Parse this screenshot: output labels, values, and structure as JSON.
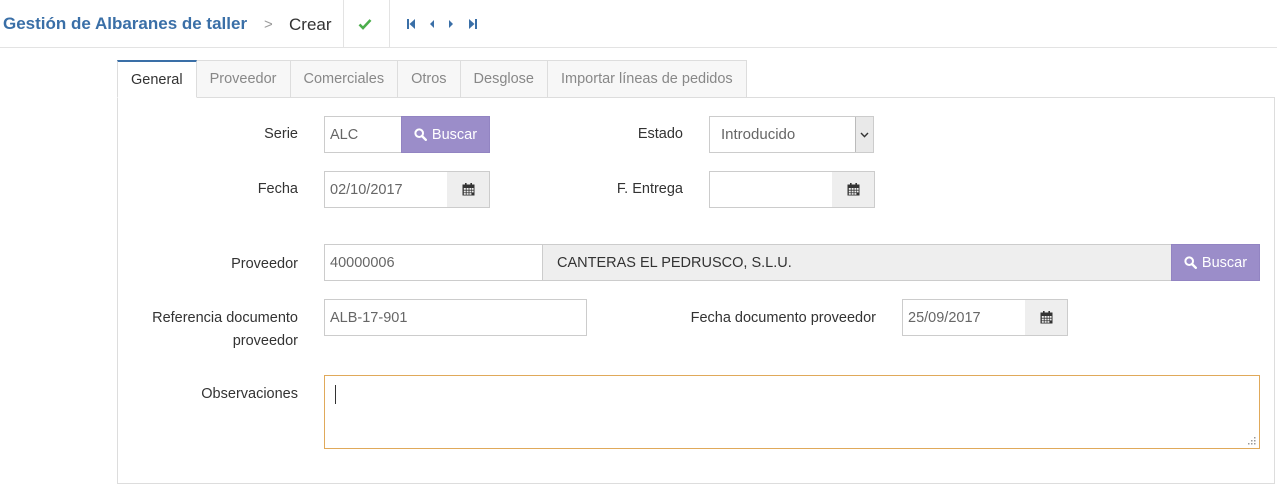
{
  "breadcrumb": {
    "app": "Gestión de Albaranes de taller",
    "separator": ">",
    "current": "Crear"
  },
  "toolbar": {
    "save_icon": "check-icon",
    "nav_icons": [
      "first-record-icon",
      "previous-record-icon",
      "next-record-icon",
      "last-record-icon"
    ],
    "colors": {
      "check": "#4cae4c",
      "nav": "#3a6fa7"
    }
  },
  "tabs": [
    {
      "label": "General",
      "active": true
    },
    {
      "label": "Proveedor",
      "active": false
    },
    {
      "label": "Comerciales",
      "active": false
    },
    {
      "label": "Otros",
      "active": false
    },
    {
      "label": "Desglose",
      "active": false
    },
    {
      "label": "Importar líneas de pedidos",
      "active": false
    }
  ],
  "form": {
    "serie": {
      "label": "Serie",
      "value": "ALC",
      "button": "Buscar"
    },
    "estado": {
      "label": "Estado",
      "value": "Introducido"
    },
    "fecha": {
      "label": "Fecha",
      "value": "02/10/2017"
    },
    "f_entrega": {
      "label": "F. Entrega",
      "value": ""
    },
    "proveedor": {
      "label": "Proveedor",
      "code": "40000006",
      "name": "CANTERAS EL PEDRUSCO, S.L.U.",
      "button": "Buscar"
    },
    "referencia": {
      "label_line1": "Referencia documento",
      "label_line2": "proveedor",
      "value": "ALB-17-901"
    },
    "fecha_doc": {
      "label": "Fecha documento proveedor",
      "value": "25/09/2017"
    },
    "observaciones": {
      "label": "Observaciones",
      "value": ""
    }
  },
  "colors": {
    "brand": "#3a6fa7",
    "button": "#9b8dc9",
    "focus_border": "#e0a95a"
  }
}
